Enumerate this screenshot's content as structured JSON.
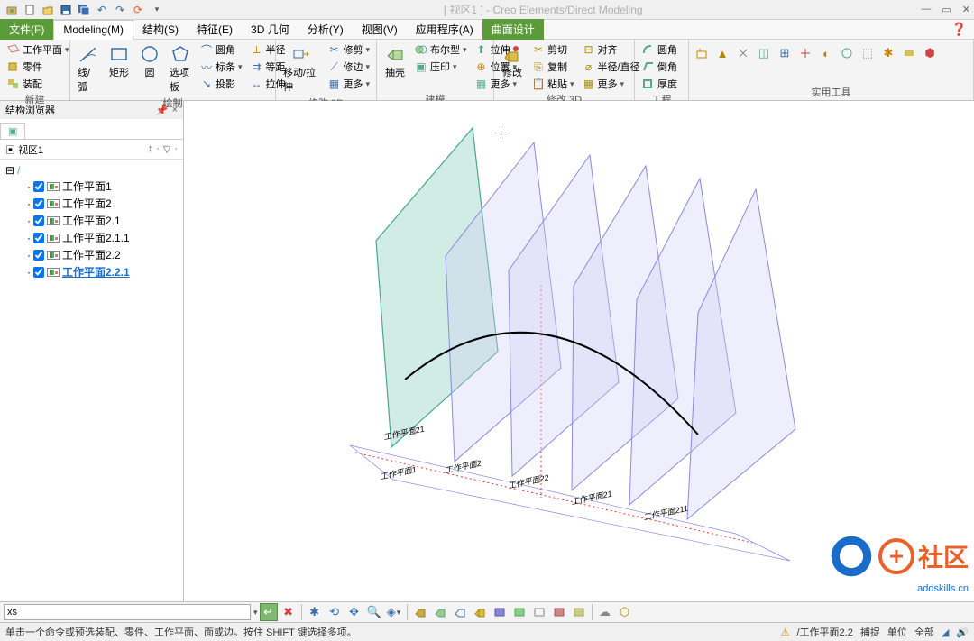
{
  "titlebar": {
    "title": "[ 视区1 ] - Creo Elements/Direct Modeling"
  },
  "menus": [
    {
      "id": "file",
      "label": "文件(F)"
    },
    {
      "id": "modeling",
      "label": "Modeling(M)"
    },
    {
      "id": "structure",
      "label": "结构(S)"
    },
    {
      "id": "feature",
      "label": "特征(E)"
    },
    {
      "id": "geom3d",
      "label": "3D 几何"
    },
    {
      "id": "analysis",
      "label": "分析(Y)"
    },
    {
      "id": "view",
      "label": "视图(V)"
    },
    {
      "id": "app",
      "label": "应用程序(A)"
    },
    {
      "id": "surface",
      "label": "曲面设计"
    }
  ],
  "active_menu": "modeling",
  "highlight_menu": "surface",
  "ribbon_groups": {
    "new": {
      "label": "新建",
      "items": [
        "工作平面",
        "零件",
        "装配"
      ]
    },
    "draw": {
      "label": "绘制",
      "big": [
        {
          "id": "line-arc",
          "label": "线/弧"
        },
        {
          "id": "rect",
          "label": "矩形"
        },
        {
          "id": "circle",
          "label": "圆"
        },
        {
          "id": "polygon",
          "label": "选项板"
        }
      ],
      "small": [
        "圆角",
        "标条",
        "投影",
        "半径",
        "等距",
        "拉伸"
      ]
    },
    "modify2d": {
      "label": "修改 2D",
      "big": [
        {
          "id": "move-stretch",
          "label": "移动/拉伸"
        }
      ],
      "small": [
        "修剪",
        "修边",
        "更多"
      ]
    },
    "model": {
      "label": "建模",
      "big": [
        {
          "id": "extrude",
          "label": "抽壳"
        }
      ],
      "small": [
        "布尔型",
        "压印",
        "拉伸",
        "位置",
        "更多"
      ]
    },
    "modify3d": {
      "label": "修改 3D",
      "big": [
        {
          "id": "modify",
          "label": "修改"
        }
      ],
      "small": [
        "剪切",
        "复制",
        "粘贴",
        "对齐",
        "半径/直径",
        "更多"
      ]
    },
    "eng": {
      "label": "工程",
      "items": [
        "圆角",
        "倒角",
        "厚度"
      ]
    },
    "util": {
      "label": "实用工具"
    }
  },
  "sidebar": {
    "title": "结构浏览器",
    "tab": "视区1",
    "tree_root": "/",
    "items": [
      {
        "label": "工作平面1"
      },
      {
        "label": "工作平面2"
      },
      {
        "label": "工作平面2.1"
      },
      {
        "label": "工作平面2.1.1"
      },
      {
        "label": "工作平面2.2"
      },
      {
        "label": "工作平面2.2.1",
        "selected": true
      }
    ]
  },
  "viewport_labels": [
    "工作平面21",
    "工作平面1",
    "工作平面2",
    "工作平面22",
    "工作平面21",
    "工作平面211"
  ],
  "cmd_input": "xs",
  "status": {
    "hint": "单击一个命令或预选装配、零件、工作平面、面或边。按住 SHIFT 键选择多项。",
    "right": [
      "/工作平面2.2",
      "捕捉",
      "单位",
      "全部"
    ]
  },
  "watermark": {
    "text": "社区",
    "url": "addskills.cn"
  }
}
